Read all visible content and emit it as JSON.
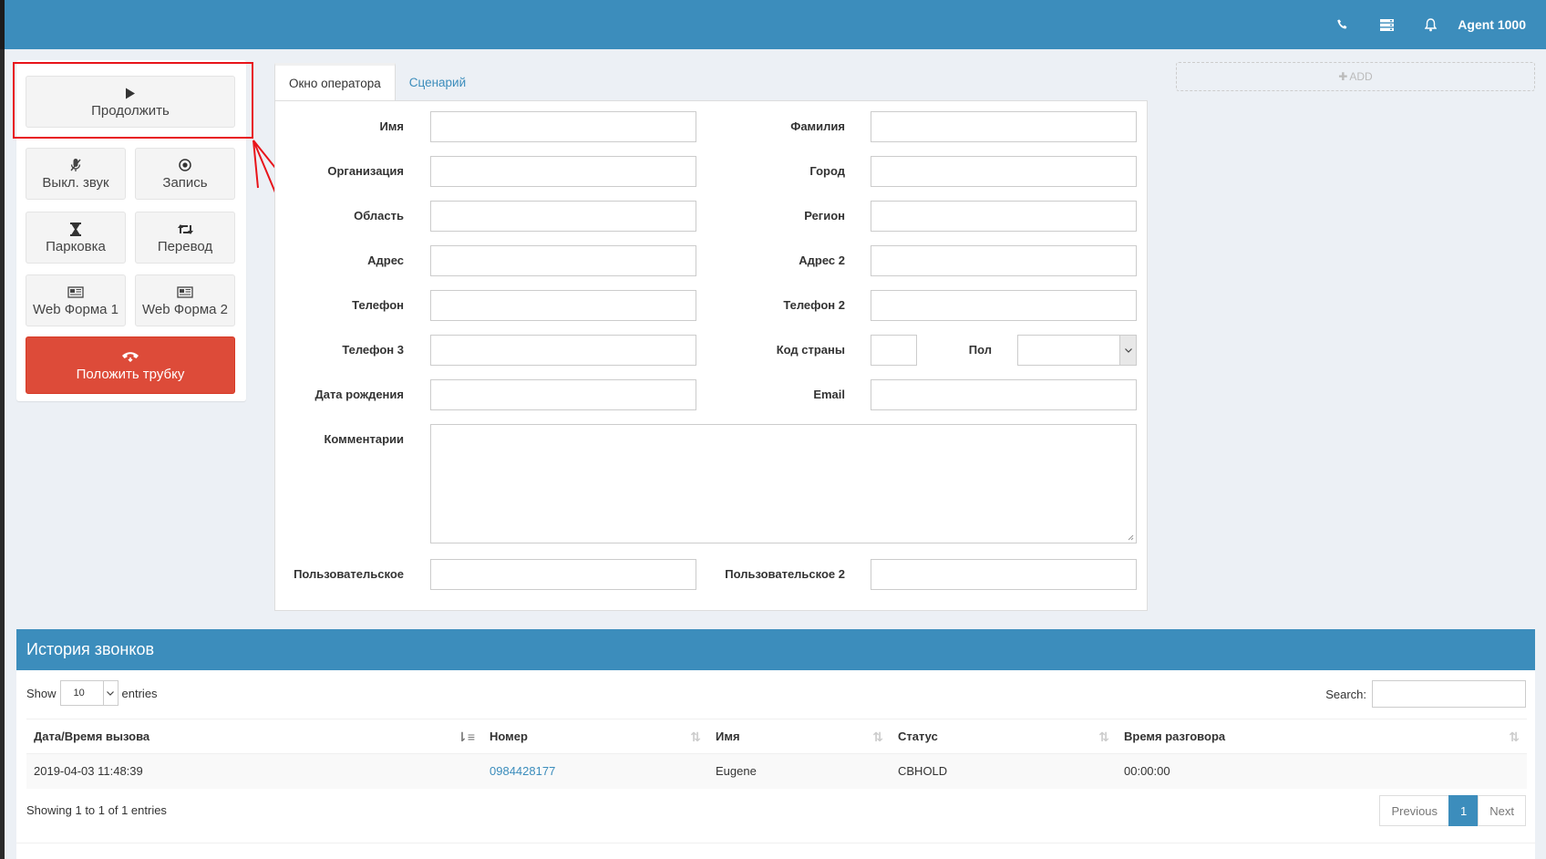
{
  "header": {
    "agent_label": "Agent 1000",
    "icons": [
      "phone-icon",
      "server-icon",
      "bell-icon"
    ]
  },
  "controls": {
    "continue_label": "Продолжить",
    "mute_label": "Выкл. звук",
    "record_label": "Запись",
    "park_label": "Парковка",
    "transfer_label": "Перевод",
    "webform1_label": "Web Форма 1",
    "webform2_label": "Web Форма 2",
    "hangup_label": "Положить трубку"
  },
  "tabs": [
    {
      "label": "Окно оператора",
      "active": true
    },
    {
      "label": "Сценарий",
      "active": false
    }
  ],
  "form": {
    "first_name": "Имя",
    "last_name": "Фамилия",
    "organization": "Организация",
    "city": "Город",
    "area": "Область",
    "region": "Регион",
    "address": "Адрес",
    "address2": "Адрес 2",
    "phone": "Телефон",
    "phone2": "Телефон 2",
    "phone3": "Телефон 3",
    "country_code": "Код страны",
    "gender": "Пол",
    "birth_date": "Дата рождения",
    "email": "Email",
    "comments": "Комментарии",
    "custom": "Пользовательское",
    "custom2": "Пользовательское 2"
  },
  "add_label": "ADD",
  "history": {
    "title": "История звонков",
    "show_label": "Show",
    "page_length": "10",
    "entries_label": "entries",
    "search_label": "Search:",
    "columns": [
      "Дата/Время вызова",
      "Номер",
      "Имя",
      "Статус",
      "Время разговора"
    ],
    "rows": [
      [
        "2019-04-03 11:48:39",
        "0984428177",
        "Eugene",
        "CBHOLD",
        "00:00:00"
      ]
    ],
    "info": "Showing 1 to 1 of 1 entries",
    "prev_label": "Previous",
    "page": "1",
    "next_label": "Next"
  },
  "colors": {
    "header": "#3c8dbc",
    "hangup": "#dd4b39",
    "highlight": "#e8141a"
  }
}
